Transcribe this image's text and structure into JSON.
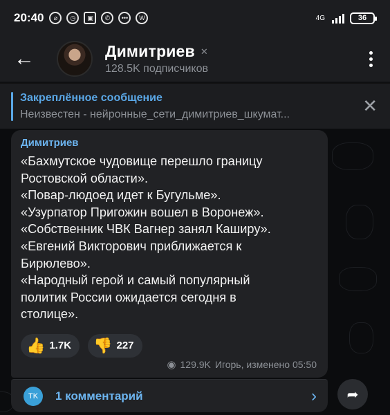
{
  "status": {
    "time": "20:40",
    "network": "4G",
    "battery": "36"
  },
  "header": {
    "title": "Димитриев",
    "subscribers": "128.5K подписчиков"
  },
  "pinned": {
    "label": "Закреплённое сообщение",
    "preview": "Неизвестен - нейронные_сети_димитриев_шкумат..."
  },
  "message": {
    "author": "Димитриев",
    "lines": [
      "«Бахмутское чудовище перешло границу",
      "Ростовской области».",
      "«Повар-людоед идет к Бугульме».",
      "«Узурпатор Пригожин вошел в Воронеж».",
      "«Собственник ЧВК Вагнер занял Каширу».",
      "«Евгений Викторович приближается к",
      "Бирюлево».",
      "«Народный герой и самый популярный",
      "политик России ожидается сегодня в",
      "столице»."
    ],
    "reactions": {
      "like_count": "1.7K",
      "dislike_count": "227"
    },
    "views": "129.9K",
    "signature": "Игорь, изменено 05:50"
  },
  "comments": {
    "avatar_initials": "TK",
    "label": "1 комментарий"
  },
  "colors": {
    "accent": "#6cb4ef",
    "bubble": "#212225",
    "header": "#1c1d20"
  }
}
